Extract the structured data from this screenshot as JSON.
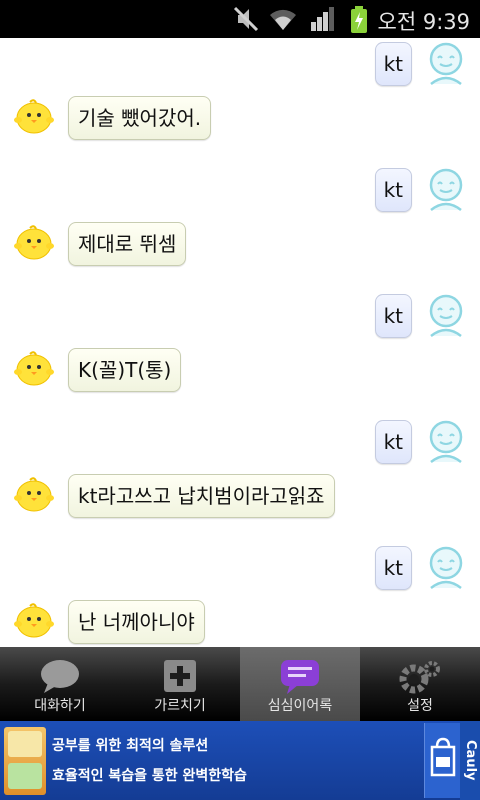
{
  "status_bar": {
    "time": "오전 9:39",
    "icons": [
      "mute-icon",
      "wifi-icon",
      "signal-icon",
      "battery-charging-icon"
    ]
  },
  "chat": {
    "messages": [
      {
        "from": "me",
        "text": "kt"
      },
      {
        "from": "bot",
        "text": "기술 뺐어갔어."
      },
      {
        "from": "me",
        "text": "kt"
      },
      {
        "from": "bot",
        "text": "제대로 뛰셈"
      },
      {
        "from": "me",
        "text": "kt"
      },
      {
        "from": "bot",
        "text": "K(꼴)T(통)"
      },
      {
        "from": "me",
        "text": "kt"
      },
      {
        "from": "bot",
        "text": "kt라고쓰고 납치범이라고읽죠"
      },
      {
        "from": "me",
        "text": "kt"
      },
      {
        "from": "bot",
        "text": "난 너께아니야"
      }
    ]
  },
  "tabs": [
    {
      "label": "대화하기",
      "icon": "speech-bubble-icon",
      "active": false
    },
    {
      "label": "가르치기",
      "icon": "plus-box-icon",
      "active": false
    },
    {
      "label": "심심이어록",
      "icon": "chat-list-icon",
      "active": true
    },
    {
      "label": "설정",
      "icon": "gear-icon",
      "active": false
    }
  ],
  "ad": {
    "line1": "공부를 위한 최적의 솔루션",
    "line2": "효율적인 복습을 통한 완벽한학습",
    "brand": "Cauly",
    "icons": [
      "ad-thumbnail",
      "shopping-bag-icon"
    ]
  },
  "colors": {
    "me_bubble": "#e6ecfc",
    "bot_bubble": "#f7f8ea",
    "active_tab": "#5a5a5a",
    "ad_background": "#1d4fb8"
  }
}
